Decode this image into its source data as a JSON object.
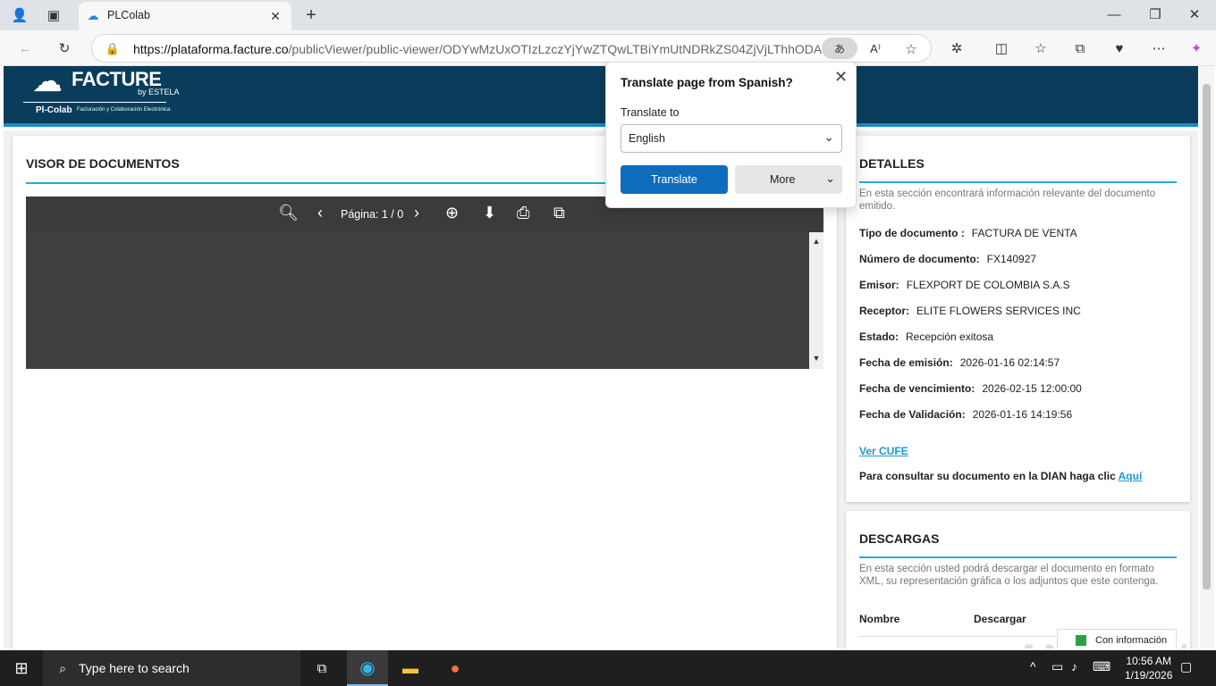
{
  "browser": {
    "tab_title": "PLColab",
    "url_host": "https://plataforma.facture.co",
    "url_path": "/publicViewer/public-viewer/ODYwMzUxOTIzLzczYjYwZTQwLTBiYmUtNDRkZS04ZjVjLThhODA...",
    "translate_pill": "あ"
  },
  "logo": {
    "brand": "FACTURE",
    "by": "by ESTELA",
    "product": "Pl-Colab",
    "tagline": "Facturación y Colaboración Electrónica"
  },
  "viewer": {
    "title": "VISOR DE DOCUMENTOS",
    "page_indicator": "Página: 1 / 0"
  },
  "details": {
    "title": "DETALLES",
    "description": "En esta sección encontrará información relevante del documento emitido.",
    "rows": [
      {
        "label": "Tipo de documento :",
        "value": "FACTURA DE VENTA"
      },
      {
        "label": "Número de documento:",
        "value": "FX140927"
      },
      {
        "label": "Emisor:",
        "value": "FLEXPORT DE COLOMBIA S.A.S"
      },
      {
        "label": "Receptor:",
        "value": "ELITE FLOWERS SERVICES INC"
      },
      {
        "label": "Estado:",
        "value": "Recepción exitosa"
      },
      {
        "label": "Fecha de emisión:",
        "value": "2026-01-16 02:14:57"
      },
      {
        "label": "Fecha de vencimiento:",
        "value": "2026-02-15 12:00:00"
      },
      {
        "label": "Fecha de Validación:",
        "value": "2026-01-16 14:19:56"
      }
    ],
    "cufe_link": "Ver CUFE",
    "dian_text": "Para consultar su documento en la DIAN haga clic",
    "dian_link": "Aquí"
  },
  "downloads": {
    "title": "DESCARGAS",
    "description": "En esta sección usted podrá descargar el documento en formato XML, su representación gráfica o los adjuntos que este contenga.",
    "col_name": "Nombre",
    "col_download": "Descargar",
    "badge": "Con información"
  },
  "translate_popup": {
    "title": "Translate page from Spanish?",
    "label": "Translate to",
    "language": "English",
    "translate_button": "Translate",
    "more_button": "More"
  },
  "taskbar": {
    "search_placeholder": "Type here to search",
    "time": "10:56 AM",
    "date": "1/19/2026"
  },
  "watermark": "ANY RUN"
}
